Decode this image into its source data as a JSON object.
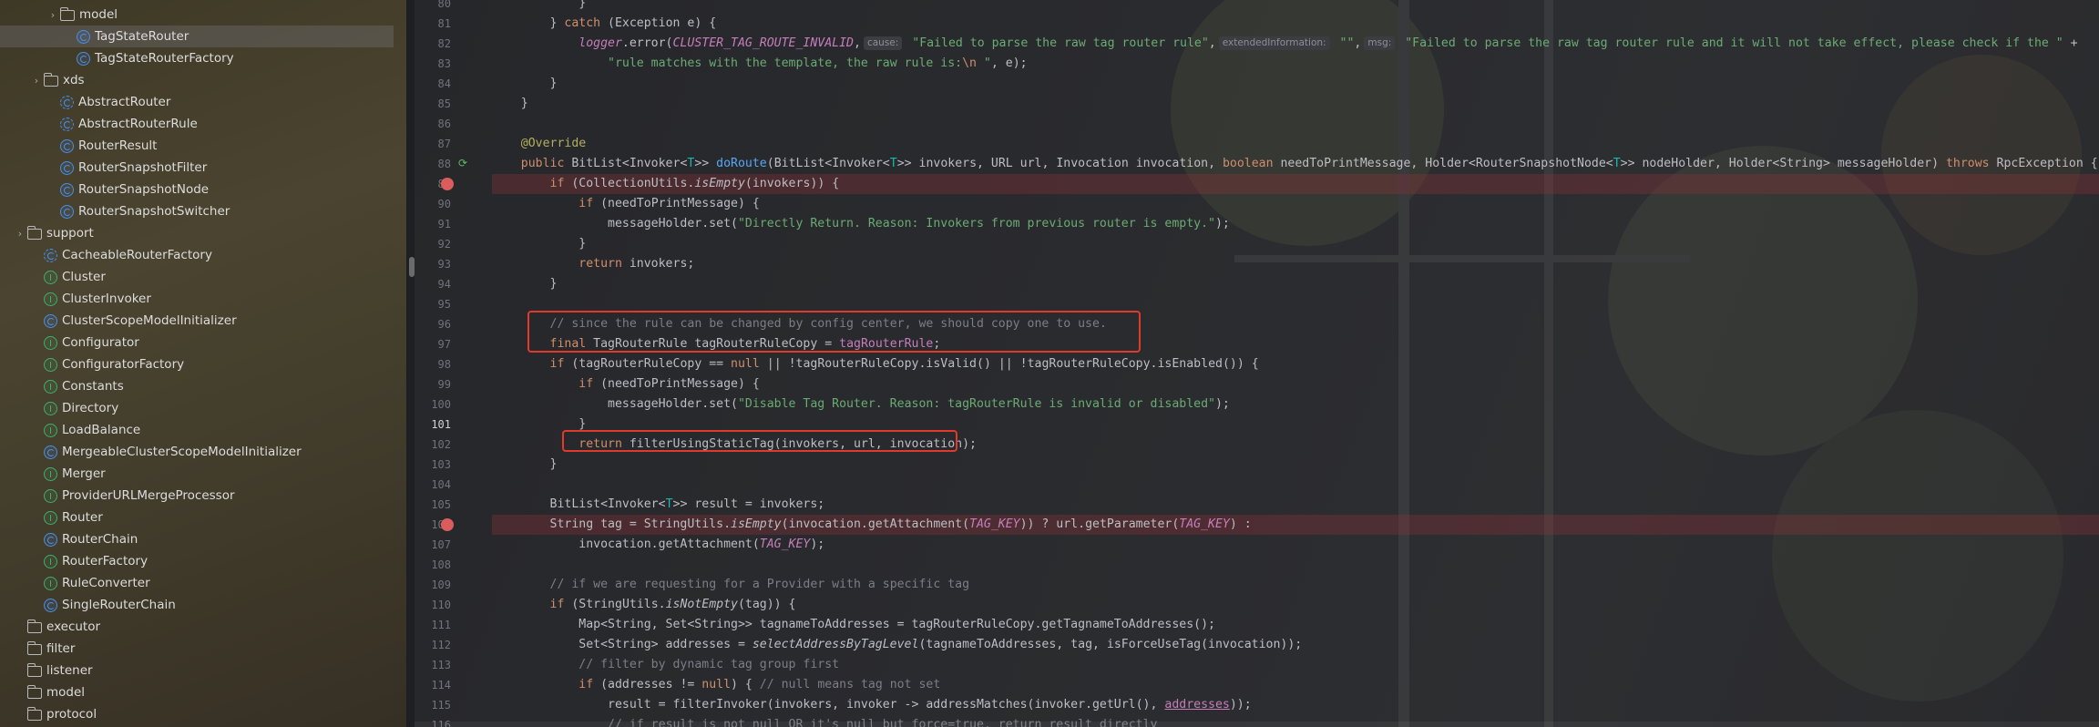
{
  "sidebar": {
    "items": [
      {
        "label": "model",
        "type": "folder",
        "indent": 2,
        "arrow": "›"
      },
      {
        "label": "TagStateRouter",
        "type": "cls",
        "indent": 3,
        "selected": true
      },
      {
        "label": "TagStateRouterFactory",
        "type": "cls",
        "indent": 3
      },
      {
        "label": "xds",
        "type": "folder",
        "indent": 1,
        "arrow": "›"
      },
      {
        "label": "AbstractRouter",
        "type": "abs",
        "indent": 2
      },
      {
        "label": "AbstractRouterRule",
        "type": "abs",
        "indent": 2
      },
      {
        "label": "RouterResult",
        "type": "cls",
        "indent": 2
      },
      {
        "label": "RouterSnapshotFilter",
        "type": "cls",
        "indent": 2
      },
      {
        "label": "RouterSnapshotNode",
        "type": "cls",
        "indent": 2
      },
      {
        "label": "RouterSnapshotSwitcher",
        "type": "cls",
        "indent": 2
      },
      {
        "label": "support",
        "type": "folder",
        "indent": 0,
        "arrow": "›"
      },
      {
        "label": "CacheableRouterFactory",
        "type": "abs",
        "indent": 1
      },
      {
        "label": "Cluster",
        "type": "intf",
        "indent": 1
      },
      {
        "label": "ClusterInvoker",
        "type": "intf",
        "indent": 1
      },
      {
        "label": "ClusterScopeModelInitializer",
        "type": "cls",
        "indent": 1
      },
      {
        "label": "Configurator",
        "type": "intf",
        "indent": 1
      },
      {
        "label": "ConfiguratorFactory",
        "type": "intf",
        "indent": 1
      },
      {
        "label": "Constants",
        "type": "intf",
        "indent": 1
      },
      {
        "label": "Directory",
        "type": "intf",
        "indent": 1
      },
      {
        "label": "LoadBalance",
        "type": "intf",
        "indent": 1
      },
      {
        "label": "MergeableClusterScopeModelInitializer",
        "type": "cls",
        "indent": 1
      },
      {
        "label": "Merger",
        "type": "intf",
        "indent": 1
      },
      {
        "label": "ProviderURLMergeProcessor",
        "type": "intf",
        "indent": 1
      },
      {
        "label": "Router",
        "type": "intf",
        "indent": 1
      },
      {
        "label": "RouterChain",
        "type": "cls",
        "indent": 1
      },
      {
        "label": "RouterFactory",
        "type": "intf",
        "indent": 1
      },
      {
        "label": "RuleConverter",
        "type": "intf",
        "indent": 1
      },
      {
        "label": "SingleRouterChain",
        "type": "cls",
        "indent": 1
      },
      {
        "label": "executor",
        "type": "folder",
        "indent": 0
      },
      {
        "label": "filter",
        "type": "folder",
        "indent": 0
      },
      {
        "label": "listener",
        "type": "folder",
        "indent": 0
      },
      {
        "label": "model",
        "type": "folder",
        "indent": 0
      },
      {
        "label": "protocol",
        "type": "folder",
        "indent": 0
      }
    ]
  },
  "editor": {
    "current_line": "101",
    "lines": [
      {
        "n": "80",
        "segs": [
          [
            "            }",
            ""
          ]
        ]
      },
      {
        "n": "81",
        "segs": [
          [
            "        } ",
            ""
          ],
          [
            "catch",
            "kw"
          ],
          [
            " (Exception e) {",
            ""
          ]
        ]
      },
      {
        "n": "82",
        "segs": [
          [
            "            ",
            ""
          ],
          [
            "logger",
            "field ital"
          ],
          [
            ".error(",
            ""
          ],
          [
            "CLUSTER_TAG_ROUTE_INVALID",
            "const"
          ],
          [
            ",",
            ""
          ],
          [
            "cause:",
            "hint"
          ],
          [
            " ",
            ""
          ],
          [
            "\"Failed to parse the raw tag router rule\"",
            "str"
          ],
          [
            ",",
            ""
          ],
          [
            "extendedInformation:",
            "hint"
          ],
          [
            " ",
            ""
          ],
          [
            "\"\"",
            "str"
          ],
          [
            ",",
            ""
          ],
          [
            "msg:",
            "hint"
          ],
          [
            " ",
            ""
          ],
          [
            "\"Failed to parse the raw tag router rule and it will not take effect, please check if the \"",
            "str"
          ],
          [
            " +",
            ""
          ]
        ]
      },
      {
        "n": "83",
        "segs": [
          [
            "                ",
            ""
          ],
          [
            "\"rule matches with the template, the raw rule is:",
            "str"
          ],
          [
            "\\n",
            "kw"
          ],
          [
            " \"",
            "str"
          ],
          [
            ", e);",
            ""
          ]
        ]
      },
      {
        "n": "84",
        "segs": [
          [
            "        }",
            ""
          ]
        ]
      },
      {
        "n": "85",
        "segs": [
          [
            "    }",
            ""
          ]
        ]
      },
      {
        "n": "86",
        "segs": [
          [
            "",
            ""
          ]
        ]
      },
      {
        "n": "87",
        "segs": [
          [
            "    ",
            ""
          ],
          [
            "@Override",
            "ann"
          ]
        ]
      },
      {
        "n": "88",
        "override": true,
        "segs": [
          [
            "    ",
            ""
          ],
          [
            "public",
            "kw"
          ],
          [
            " BitList<Invoker<",
            ""
          ],
          [
            "T",
            "tp"
          ],
          [
            ">> ",
            ""
          ],
          [
            "doRoute",
            "fn"
          ],
          [
            "(BitList<Invoker<",
            ""
          ],
          [
            "T",
            "tp"
          ],
          [
            ">> invokers, URL url, Invocation invocation, ",
            ""
          ],
          [
            "boolean",
            "kw"
          ],
          [
            " needToPrintMessage, Holder<RouterSnapshotNode<",
            ""
          ],
          [
            "T",
            "tp"
          ],
          [
            ">> nodeHolder, Holder<String> messageHolder) ",
            ""
          ],
          [
            "throws",
            "kw"
          ],
          [
            " RpcException {",
            ""
          ]
        ]
      },
      {
        "n": "89",
        "bp": true,
        "segs": [
          [
            "        ",
            ""
          ],
          [
            "if",
            "kw"
          ],
          [
            " (CollectionUtils.",
            ""
          ],
          [
            "isEmpty",
            "ital"
          ],
          [
            "(invokers)) {",
            ""
          ]
        ]
      },
      {
        "n": "90",
        "segs": [
          [
            "            ",
            ""
          ],
          [
            "if",
            "kw"
          ],
          [
            " (needToPrintMessage) {",
            ""
          ]
        ]
      },
      {
        "n": "91",
        "segs": [
          [
            "                messageHolder.set(",
            ""
          ],
          [
            "\"Directly Return. Reason: Invokers from previous router is empty.\"",
            "str"
          ],
          [
            ");",
            ""
          ]
        ]
      },
      {
        "n": "92",
        "segs": [
          [
            "            }",
            ""
          ]
        ]
      },
      {
        "n": "93",
        "segs": [
          [
            "            ",
            ""
          ],
          [
            "return",
            "kw"
          ],
          [
            " invokers;",
            ""
          ]
        ]
      },
      {
        "n": "94",
        "segs": [
          [
            "        }",
            ""
          ]
        ]
      },
      {
        "n": "95",
        "segs": [
          [
            "",
            ""
          ]
        ]
      },
      {
        "n": "96",
        "segs": [
          [
            "        ",
            ""
          ],
          [
            "// since the rule can be changed by config center, we should copy one to use.",
            "cmt"
          ]
        ]
      },
      {
        "n": "97",
        "segs": [
          [
            "        ",
            ""
          ],
          [
            "final",
            "kw"
          ],
          [
            " TagRouterRule tagRouterRuleCopy = ",
            ""
          ],
          [
            "tagRouterRule",
            "field"
          ],
          [
            ";",
            ""
          ]
        ]
      },
      {
        "n": "98",
        "segs": [
          [
            "        ",
            ""
          ],
          [
            "if",
            "kw"
          ],
          [
            " (tagRouterRuleCopy == ",
            ""
          ],
          [
            "null",
            "kw"
          ],
          [
            " || !tagRouterRuleCopy.isValid() || !tagRouterRuleCopy.isEnabled()) {",
            ""
          ]
        ]
      },
      {
        "n": "99",
        "segs": [
          [
            "            ",
            ""
          ],
          [
            "if",
            "kw"
          ],
          [
            " (needToPrintMessage) {",
            ""
          ]
        ]
      },
      {
        "n": "100",
        "segs": [
          [
            "                messageHolder.set(",
            ""
          ],
          [
            "\"Disable Tag Router. Reason: tagRouterRule is invalid or disabled\"",
            "str"
          ],
          [
            ");",
            ""
          ]
        ]
      },
      {
        "n": "101",
        "segs": [
          [
            "            }",
            ""
          ]
        ]
      },
      {
        "n": "102",
        "segs": [
          [
            "            ",
            ""
          ],
          [
            "return",
            "kw"
          ],
          [
            " filterUsingStaticTag(invokers, url, invocation);",
            ""
          ]
        ]
      },
      {
        "n": "103",
        "segs": [
          [
            "        }",
            ""
          ]
        ]
      },
      {
        "n": "104",
        "segs": [
          [
            "",
            ""
          ]
        ]
      },
      {
        "n": "105",
        "segs": [
          [
            "        BitList<Invoker<",
            ""
          ],
          [
            "T",
            "tp"
          ],
          [
            ">> result = invokers;",
            ""
          ]
        ]
      },
      {
        "n": "106",
        "bp": true,
        "segs": [
          [
            "        String tag = StringUtils.",
            ""
          ],
          [
            "isEmpty",
            "ital"
          ],
          [
            "(invocation.getAttachment(",
            ""
          ],
          [
            "TAG_KEY",
            "const"
          ],
          [
            ")) ? url.getParameter(",
            ""
          ],
          [
            "TAG_KEY",
            "const"
          ],
          [
            ") :",
            ""
          ]
        ]
      },
      {
        "n": "107",
        "segs": [
          [
            "            invocation.getAttachment(",
            ""
          ],
          [
            "TAG_KEY",
            "const"
          ],
          [
            ");",
            ""
          ]
        ]
      },
      {
        "n": "108",
        "segs": [
          [
            "",
            ""
          ]
        ]
      },
      {
        "n": "109",
        "segs": [
          [
            "        ",
            ""
          ],
          [
            "// if we are requesting for a Provider with a specific tag",
            "cmt"
          ]
        ]
      },
      {
        "n": "110",
        "segs": [
          [
            "        ",
            ""
          ],
          [
            "if",
            "kw"
          ],
          [
            " (StringUtils.",
            ""
          ],
          [
            "isNotEmpty",
            "ital"
          ],
          [
            "(tag)) {",
            ""
          ]
        ]
      },
      {
        "n": "111",
        "segs": [
          [
            "            Map<String, Set<String>> tagnameToAddresses = tagRouterRuleCopy.getTagnameToAddresses();",
            ""
          ]
        ]
      },
      {
        "n": "112",
        "segs": [
          [
            "            Set<String> addresses = ",
            ""
          ],
          [
            "selectAddressByTagLevel",
            "ital"
          ],
          [
            "(tagnameToAddresses, tag, isForceUseTag(invocation));",
            ""
          ]
        ]
      },
      {
        "n": "113",
        "segs": [
          [
            "            ",
            ""
          ],
          [
            "// filter by dynamic tag group first",
            "cmt"
          ]
        ]
      },
      {
        "n": "114",
        "segs": [
          [
            "            ",
            ""
          ],
          [
            "if",
            "kw"
          ],
          [
            " (addresses != ",
            ""
          ],
          [
            "null",
            "kw"
          ],
          [
            ") { ",
            ""
          ],
          [
            "// null means tag not set",
            "cmt"
          ]
        ]
      },
      {
        "n": "115",
        "segs": [
          [
            "                result = filterInvoker(invokers, invoker -> addressMatches(invoker.getUrl(), ",
            ""
          ],
          [
            "addresses",
            "field und"
          ],
          [
            "));",
            ""
          ]
        ]
      },
      {
        "n": "116",
        "segs": [
          [
            "                ",
            ""
          ],
          [
            "// if result is not null OR it's null but force=true, return result directly",
            "cmt"
          ]
        ]
      }
    ]
  }
}
